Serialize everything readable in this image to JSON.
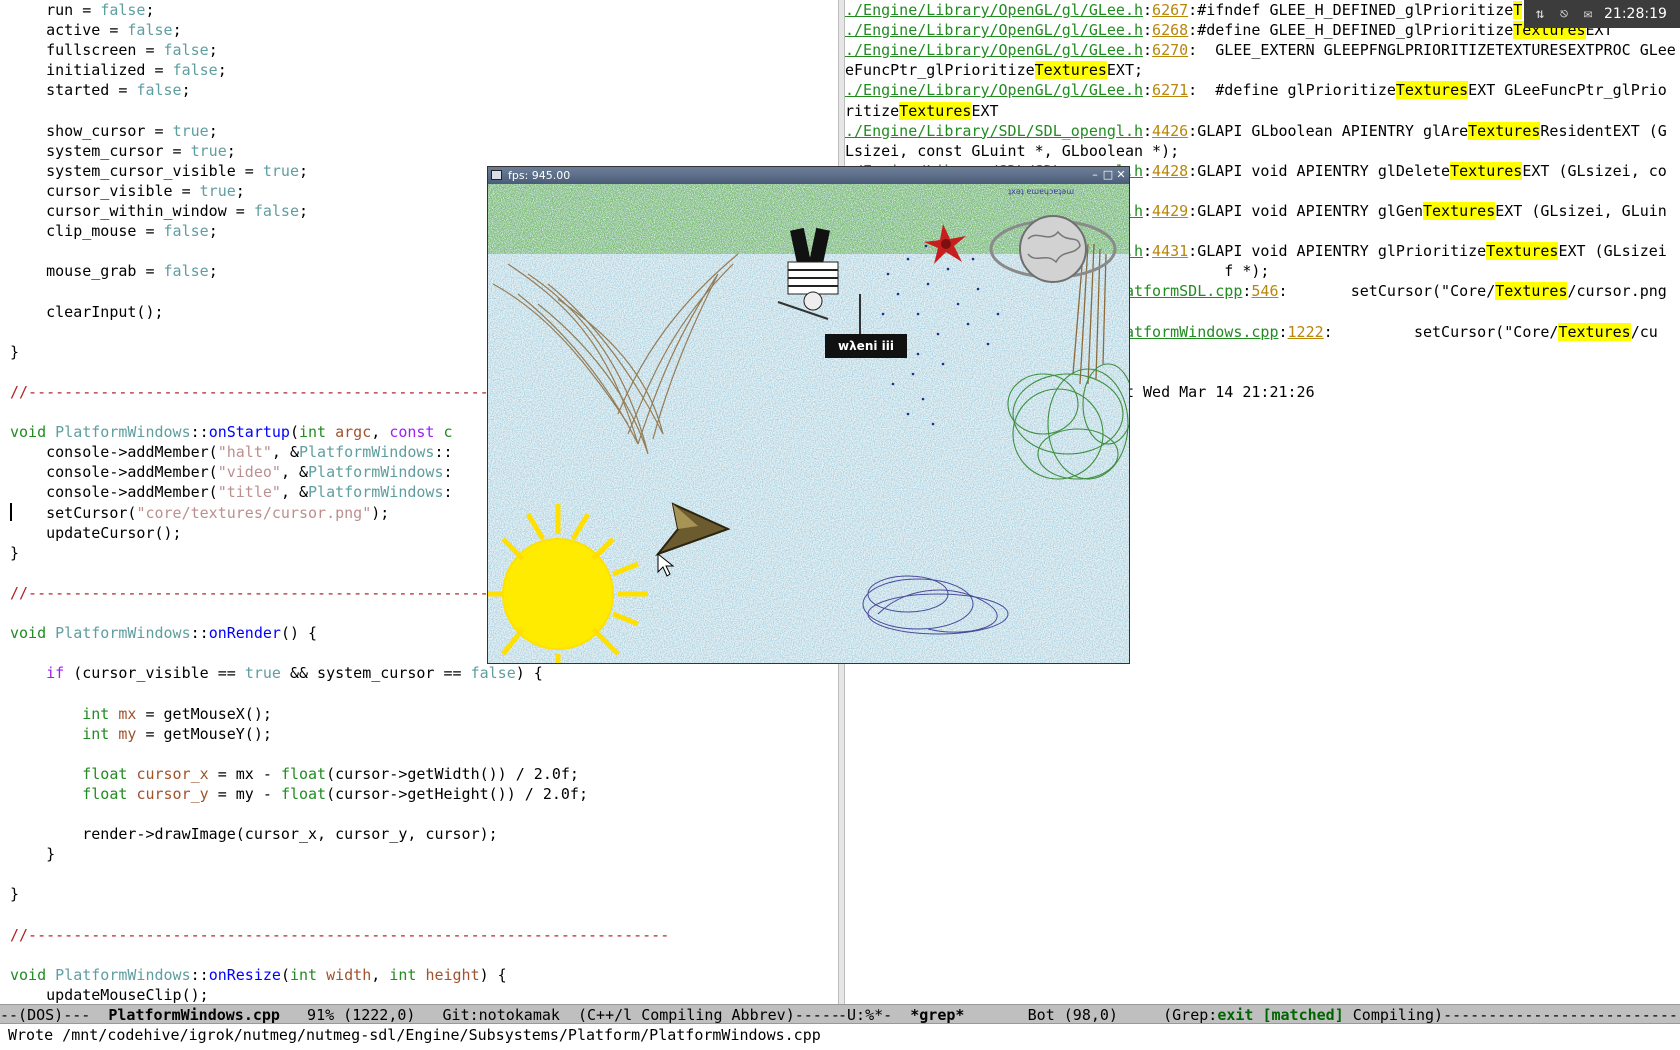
{
  "left_buffer": {
    "lines": [
      [
        {
          "t": "    run = "
        },
        {
          "t": "false",
          "c": "const"
        },
        {
          "t": ";"
        }
      ],
      [
        {
          "t": "    active = "
        },
        {
          "t": "false",
          "c": "const"
        },
        {
          "t": ";"
        }
      ],
      [
        {
          "t": "    fullscreen = "
        },
        {
          "t": "false",
          "c": "const"
        },
        {
          "t": ";"
        }
      ],
      [
        {
          "t": "    initialized = "
        },
        {
          "t": "false",
          "c": "const"
        },
        {
          "t": ";"
        }
      ],
      [
        {
          "t": "    started = "
        },
        {
          "t": "false",
          "c": "const"
        },
        {
          "t": ";"
        }
      ],
      [
        {
          "t": ""
        }
      ],
      [
        {
          "t": "    show_cursor = "
        },
        {
          "t": "true",
          "c": "const"
        },
        {
          "t": ";"
        }
      ],
      [
        {
          "t": "    system_cursor = "
        },
        {
          "t": "true",
          "c": "const"
        },
        {
          "t": ";"
        }
      ],
      [
        {
          "t": "    system_cursor_visible = "
        },
        {
          "t": "true",
          "c": "const"
        },
        {
          "t": ";"
        }
      ],
      [
        {
          "t": "    cursor_visible = "
        },
        {
          "t": "true",
          "c": "const"
        },
        {
          "t": ";"
        }
      ],
      [
        {
          "t": "    cursor_within_window = "
        },
        {
          "t": "false",
          "c": "const"
        },
        {
          "t": ";"
        }
      ],
      [
        {
          "t": "    clip_mouse = "
        },
        {
          "t": "false",
          "c": "const"
        },
        {
          "t": ";"
        }
      ],
      [
        {
          "t": ""
        }
      ],
      [
        {
          "t": "    mouse_grab = "
        },
        {
          "t": "false",
          "c": "const"
        },
        {
          "t": ";"
        }
      ],
      [
        {
          "t": ""
        }
      ],
      [
        {
          "t": "    clearInput();"
        }
      ],
      [
        {
          "t": ""
        }
      ],
      [
        {
          "t": "}"
        }
      ],
      [
        {
          "t": ""
        }
      ],
      [
        {
          "t": "//-----------------------------------------------------------------------",
          "c": "cm"
        }
      ],
      [
        {
          "t": ""
        }
      ],
      [
        {
          "t": "void ",
          "c": "type"
        },
        {
          "t": "PlatformWindows",
          "c": "const"
        },
        {
          "t": "::"
        },
        {
          "t": "onStartup",
          "c": "fn"
        },
        {
          "t": "("
        },
        {
          "t": "int ",
          "c": "type"
        },
        {
          "t": "argc",
          "c": "var"
        },
        {
          "t": ", "
        },
        {
          "t": "const ",
          "c": "kw"
        },
        {
          "t": "c",
          "c": "type"
        }
      ],
      [
        {
          "t": "    console->addMember("
        },
        {
          "t": "\"halt\"",
          "c": "str"
        },
        {
          "t": ", &"
        },
        {
          "t": "PlatformWindows",
          "c": "const"
        },
        {
          "t": "::"
        }
      ],
      [
        {
          "t": "    console->addMember("
        },
        {
          "t": "\"video\"",
          "c": "str"
        },
        {
          "t": ", &"
        },
        {
          "t": "PlatformWindows",
          "c": "const"
        },
        {
          "t": ":"
        }
      ],
      [
        {
          "t": "    console->addMember("
        },
        {
          "t": "\"title\"",
          "c": "str"
        },
        {
          "t": ", &"
        },
        {
          "t": "PlatformWindows",
          "c": "const"
        },
        {
          "t": ":"
        }
      ],
      [
        {
          "t": "    setCursor("
        },
        {
          "t": "\"core/textures/cursor.png\"",
          "c": "str"
        },
        {
          "t": ");"
        }
      ],
      [
        {
          "t": "    updateCursor();"
        }
      ],
      [
        {
          "t": "}"
        }
      ],
      [
        {
          "t": ""
        }
      ],
      [
        {
          "t": "//-----------------------------------------------------------------------",
          "c": "cm"
        }
      ],
      [
        {
          "t": ""
        }
      ],
      [
        {
          "t": "void ",
          "c": "type"
        },
        {
          "t": "PlatformWindows",
          "c": "const"
        },
        {
          "t": "::"
        },
        {
          "t": "onRender",
          "c": "fn"
        },
        {
          "t": "() {"
        }
      ],
      [
        {
          "t": ""
        }
      ],
      [
        {
          "t": "    "
        },
        {
          "t": "if",
          "c": "kw"
        },
        {
          "t": " (cursor_visible == "
        },
        {
          "t": "true",
          "c": "const"
        },
        {
          "t": " && system_cursor == "
        },
        {
          "t": "false",
          "c": "const"
        },
        {
          "t": ") {"
        }
      ],
      [
        {
          "t": ""
        }
      ],
      [
        {
          "t": "        "
        },
        {
          "t": "int ",
          "c": "type"
        },
        {
          "t": "mx",
          "c": "var"
        },
        {
          "t": " = getMouseX();"
        }
      ],
      [
        {
          "t": "        "
        },
        {
          "t": "int ",
          "c": "type"
        },
        {
          "t": "my",
          "c": "var"
        },
        {
          "t": " = getMouseY();"
        }
      ],
      [
        {
          "t": ""
        }
      ],
      [
        {
          "t": "        "
        },
        {
          "t": "float ",
          "c": "type"
        },
        {
          "t": "cursor_x",
          "c": "var"
        },
        {
          "t": " = mx - "
        },
        {
          "t": "float",
          "c": "type"
        },
        {
          "t": "(cursor->getWidth()) / 2.0f;"
        }
      ],
      [
        {
          "t": "        "
        },
        {
          "t": "float ",
          "c": "type"
        },
        {
          "t": "cursor_y",
          "c": "var"
        },
        {
          "t": " = my - "
        },
        {
          "t": "float",
          "c": "type"
        },
        {
          "t": "(cursor->getHeight()) / 2.0f;"
        }
      ],
      [
        {
          "t": ""
        }
      ],
      [
        {
          "t": "        render->drawImage(cursor_x, cursor_y, cursor);"
        }
      ],
      [
        {
          "t": "    }"
        }
      ],
      [
        {
          "t": ""
        }
      ],
      [
        {
          "t": "}"
        }
      ],
      [
        {
          "t": ""
        }
      ],
      [
        {
          "t": "//-----------------------------------------------------------------------",
          "c": "cm"
        }
      ],
      [
        {
          "t": ""
        }
      ],
      [
        {
          "t": "void ",
          "c": "type"
        },
        {
          "t": "PlatformWindows",
          "c": "const"
        },
        {
          "t": "::"
        },
        {
          "t": "onResize",
          "c": "fn"
        },
        {
          "t": "("
        },
        {
          "t": "int ",
          "c": "type"
        },
        {
          "t": "width",
          "c": "var"
        },
        {
          "t": ", "
        },
        {
          "t": "int ",
          "c": "type"
        },
        {
          "t": "height",
          "c": "var"
        },
        {
          "t": ") {"
        }
      ],
      [
        {
          "t": "    updateMouseClip();"
        }
      ]
    ]
  },
  "right_buffer": {
    "lines": [
      [
        {
          "t": "./Engine/Library/OpenGL/gl/GLee.h",
          "c": "fname"
        },
        {
          "t": ":"
        },
        {
          "t": "6267",
          "c": "lnum"
        },
        {
          "t": ":#ifndef GLEE_H_DEFINED_glPrioritize"
        },
        {
          "t": "T",
          "c": "hl"
        }
      ],
      [
        {
          "t": "./Engine/Library/OpenGL/gl/GLee.h",
          "c": "fname"
        },
        {
          "t": ":"
        },
        {
          "t": "6268",
          "c": "lnum"
        },
        {
          "t": ":#define GLEE_H_DEFINED_glPrioritize"
        },
        {
          "t": "Textures",
          "c": "hl"
        },
        {
          "t": "EXT"
        }
      ],
      [
        {
          "t": "./Engine/Library/OpenGL/gl/GLee.h",
          "c": "fname"
        },
        {
          "t": ":"
        },
        {
          "t": "6270",
          "c": "lnum"
        },
        {
          "t": ":  GLEE_EXTERN GLEEPFNGLPRIORITIZETEXTURESEXTPROC GLee"
        }
      ],
      [
        {
          "t": "eFuncPtr_glPrioritize"
        },
        {
          "t": "Textures",
          "c": "hl"
        },
        {
          "t": "EXT;"
        }
      ],
      [
        {
          "t": "./Engine/Library/OpenGL/gl/GLee.h",
          "c": "fname"
        },
        {
          "t": ":"
        },
        {
          "t": "6271",
          "c": "lnum"
        },
        {
          "t": ":  #define glPrioritize"
        },
        {
          "t": "Textures",
          "c": "hl"
        },
        {
          "t": "EXT GLeeFuncPtr_glPrio"
        }
      ],
      [
        {
          "t": "ritize"
        },
        {
          "t": "Textures",
          "c": "hl"
        },
        {
          "t": "EXT"
        }
      ],
      [
        {
          "t": "./Engine/Library/SDL/SDL_opengl.h",
          "c": "fname"
        },
        {
          "t": ":"
        },
        {
          "t": "4426",
          "c": "lnum"
        },
        {
          "t": ":GLAPI GLboolean APIENTRY glAre"
        },
        {
          "t": "Textures",
          "c": "hl"
        },
        {
          "t": "ResidentEXT (G"
        }
      ],
      [
        {
          "t": "Lsizei, const GLuint *, GLboolean *);"
        }
      ],
      [
        {
          "t": "./Engine/Library/SDL/SDL_opengl.h",
          "c": "fname"
        },
        {
          "t": ":"
        },
        {
          "t": "4428",
          "c": "lnum"
        },
        {
          "t": ":GLAPI void APIENTRY glDelete"
        },
        {
          "t": "Textures",
          "c": "hl"
        },
        {
          "t": "EXT (GLsizei, co"
        }
      ],
      [
        {
          "t": ""
        }
      ],
      [
        {
          "t": "./Engine/Library/SDL/SDL_opengl.h",
          "c": "fname"
        },
        {
          "t": ":"
        },
        {
          "t": "4429",
          "c": "lnum"
        },
        {
          "t": ":GLAPI void APIENTRY glGen"
        },
        {
          "t": "Textures",
          "c": "hl"
        },
        {
          "t": "EXT (GLsizei, GLuin"
        }
      ],
      [
        {
          "t": ""
        }
      ],
      [
        {
          "t": "./Engine/Library/SDL/SDL_opengl.h",
          "c": "fname"
        },
        {
          "t": ":"
        },
        {
          "t": "4431",
          "c": "lnum"
        },
        {
          "t": ":GLAPI void APIENTRY glPrioritize"
        },
        {
          "t": "Textures",
          "c": "hl"
        },
        {
          "t": "EXT (GLsizei"
        }
      ],
      [
        {
          "t": "                                          f *);"
        }
      ],
      [
        {
          "t": "./Engine/Subsystems/Platform/PlatformSDL.cpp",
          "c": "fname"
        },
        {
          "t": ":"
        },
        {
          "t": "546",
          "c": "lnum"
        },
        {
          "t": ":       setCursor(\"Core/"
        },
        {
          "t": "Textures",
          "c": "hl"
        },
        {
          "t": "/cursor.png"
        }
      ],
      [
        {
          "t": ""
        }
      ],
      [
        {
          "t": "./Engine/Subsystems/Platform/PlatformWindows.cpp",
          "c": "fname"
        },
        {
          "t": ":"
        },
        {
          "t": "1222",
          "c": "lnum"
        },
        {
          "t": ":         setCursor(\"Core/"
        },
        {
          "t": "Textures",
          "c": "hl"
        },
        {
          "t": "/cu"
        }
      ],
      [
        {
          "t": ""
        }
      ],
      [
        {
          "t": ""
        }
      ],
      [
        {
          "t": "Grep finished (matches found) at Wed Mar 14 21:21:26"
        }
      ]
    ]
  },
  "modeline_left": {
    "prefix": "--(DOS)---  ",
    "buffer": "PlatformWindows.cpp",
    "rest": "   91% (1222,0)   Git:notokamak  (C++/l Compiling Abbrev)------------------"
  },
  "modeline_right": {
    "prefix": "-U:%*-  ",
    "buffer": "*grep*",
    "mid": "       Bot (98,0)     (Grep:",
    "status": "exit [matched]",
    "rest": " Compiling)--------------------------------"
  },
  "minibuffer": "Wrote /mnt/codehive/igrok/nutmeg/nutmeg-sdl/Engine/Subsystems/Platform/PlatformWindows.cpp",
  "game_window": {
    "title": "fps: 945.00",
    "sign_text": "wλeni iii",
    "corner_text": "ʇxǝʇ ɐɯɐɥɔɐʇǝɯ"
  },
  "tray": {
    "clock": "21:28:19",
    "icons": [
      "network-icon",
      "power-icon",
      "mail-icon"
    ]
  },
  "colors": {
    "keyword": "#a020f0",
    "type": "#228b22",
    "constant": "#5f9ea0",
    "function": "#0000ff",
    "string": "#bc8f8f",
    "variable": "#a0522d",
    "comment": "#b22222",
    "highlight": "#ffff00",
    "modeline": "#bfbfbf"
  }
}
